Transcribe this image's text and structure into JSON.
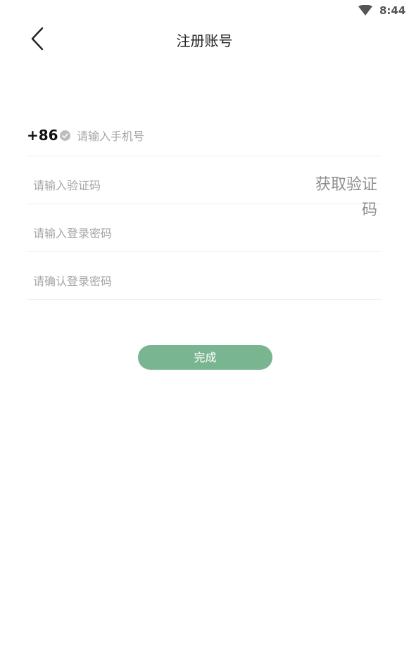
{
  "status_bar": {
    "time": "8:44",
    "wifi_icon": "wifi-icon"
  },
  "header": {
    "back_icon": "chevron-left-icon",
    "title": "注册账号"
  },
  "form": {
    "country_code": "+86",
    "country_check_icon": "check-circle-icon",
    "phone_placeholder": "请输入手机号",
    "code_placeholder": "请输入验证码",
    "get_code_label": "获取验证码",
    "password_placeholder": "请输入登录密码",
    "confirm_password_placeholder": "请确认登录密码",
    "submit_label": "完成"
  },
  "colors": {
    "accent": "#79b590",
    "placeholder": "#a7a7a7",
    "divider": "#ececec"
  }
}
